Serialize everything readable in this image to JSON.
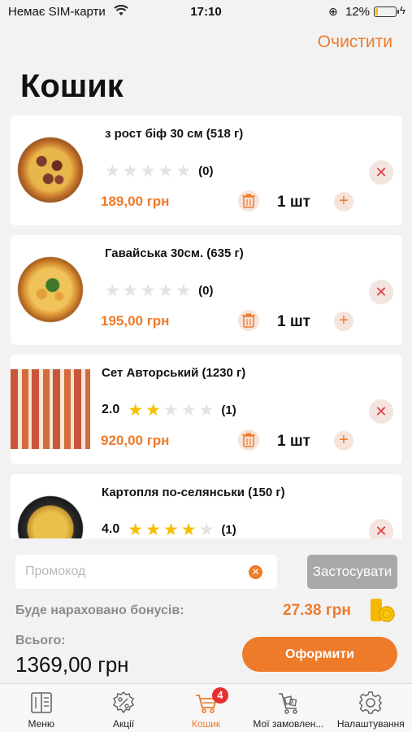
{
  "status_bar": {
    "carrier": "Немає SIM-карти",
    "time": "17:10",
    "battery": "12%",
    "battery_level": 0.12
  },
  "header": {
    "clear_label": "Очистити",
    "title": "Кошик"
  },
  "cart": {
    "items": [
      {
        "name": "з рост біф 30 см (518 г)",
        "rating": "",
        "stars": 0,
        "rating_count": "(0)",
        "price": "189,00 грн",
        "quantity": "1 шт",
        "image": "pizza-roast-beef"
      },
      {
        "name": "Гавайська 30см. (635 г)",
        "rating": "",
        "stars": 0,
        "rating_count": "(0)",
        "price": "195,00 грн",
        "quantity": "1 шт",
        "image": "pizza-hawaiian"
      },
      {
        "name": "Сет Авторський (1230 г)",
        "rating": "2.0",
        "stars": 2,
        "rating_count": "(1)",
        "price": "920,00 грн",
        "quantity": "1 шт",
        "image": "sushi-set"
      },
      {
        "name": "Картопля по-селянськи  (150 г)",
        "rating": "4.0",
        "stars": 4,
        "rating_count": "(1)",
        "price": "",
        "quantity": "",
        "image": "potato-wedges"
      }
    ]
  },
  "promo": {
    "placeholder": "Промокод",
    "apply_label": "Застосувати"
  },
  "bonus": {
    "label": "Буде нараховано бонусів:",
    "value": "27.38 грн"
  },
  "total": {
    "label": "Всього:",
    "value": "1369,00 грн"
  },
  "checkout_label": "Оформити",
  "tabs": [
    {
      "label": "Меню",
      "icon": "menu-book-icon"
    },
    {
      "label": "Акції",
      "icon": "discount-icon"
    },
    {
      "label": "Кошик",
      "icon": "cart-icon",
      "badge": "4",
      "active": true
    },
    {
      "label": "Мої замовлен...",
      "icon": "orders-cart-icon"
    },
    {
      "label": "Налаштування",
      "icon": "gear-icon"
    }
  ],
  "colors": {
    "accent": "#ee7b2a",
    "star": "#f5c000",
    "disabled": "#a8a8a8",
    "badge": "#e63030"
  }
}
